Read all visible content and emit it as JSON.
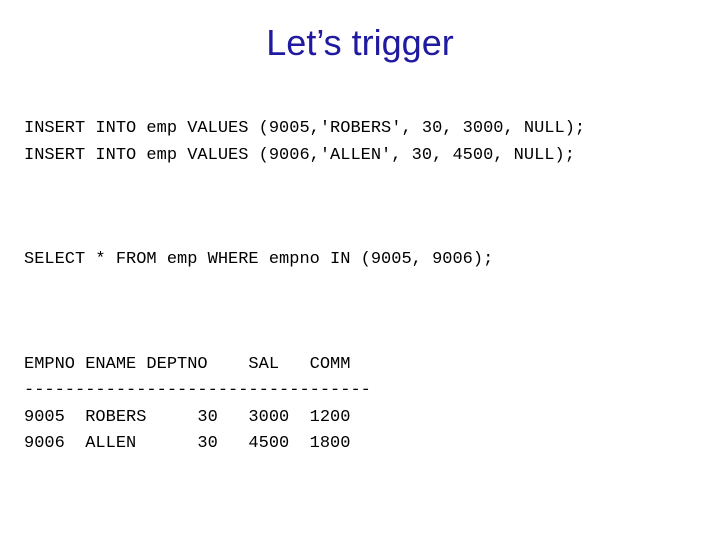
{
  "title": "Let’s trigger",
  "code": {
    "insert1": "INSERT INTO emp VALUES (9005,'ROBERS', 30, 3000, NULL);",
    "insert2": "INSERT INTO emp VALUES (9006,'ALLEN', 30, 4500, NULL);",
    "select": "SELECT * FROM emp WHERE empno IN (9005, 9006);",
    "header": "EMPNO ENAME DEPTNO    SAL   COMM",
    "divider": "----------------------------------",
    "row1": "9005  ROBERS     30   3000  1200",
    "row2": "9006  ALLEN      30   4500  1800"
  },
  "chart_data": {
    "type": "table",
    "columns": [
      "EMPNO",
      "ENAME",
      "DEPTNO",
      "SAL",
      "COMM"
    ],
    "rows": [
      [
        9005,
        "ROBERS",
        30,
        3000,
        1200
      ],
      [
        9006,
        "ALLEN",
        30,
        4500,
        1800
      ]
    ]
  }
}
